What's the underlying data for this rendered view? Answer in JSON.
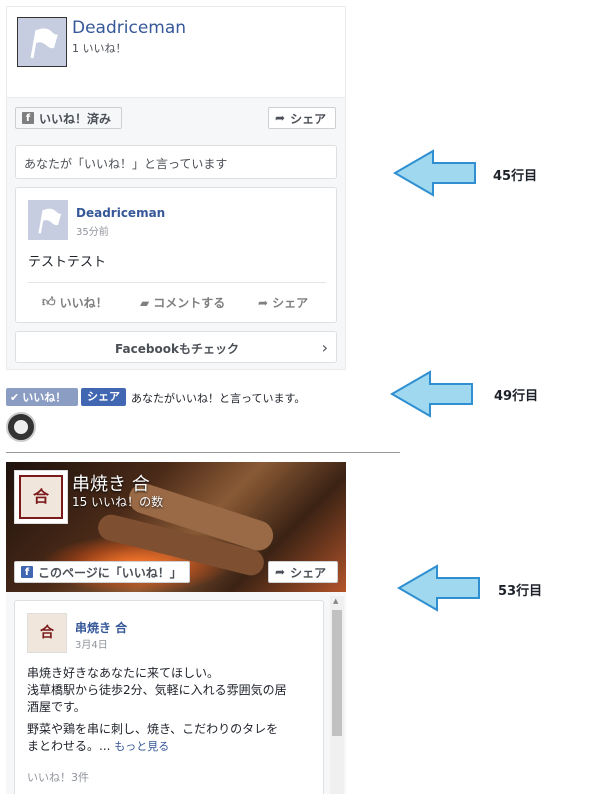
{
  "plugin1": {
    "page_name": "Deadriceman",
    "likes": "1 いいね！",
    "liked_button": "いいね！済み",
    "share_button": "シェア",
    "you_like": "あなたが「いいね！」と言っています",
    "post": {
      "author": "Deadriceman",
      "time": "35分前",
      "text": "テストテスト",
      "like": "いいね！",
      "comment": "コメントする",
      "share": "シェア"
    },
    "check_facebook": "Facebookもチェック"
  },
  "plugin2": {
    "like_button": "いいね！",
    "share_button": "シェア",
    "status_text": "あなたがいいね！と言っています。"
  },
  "plugin3": {
    "page_name": "串焼き 合",
    "likes": "15 いいね！の数",
    "like_page_button": "このページに「いいね！」",
    "share_button": "シェア",
    "post": {
      "author": "串焼き 合",
      "date": "3月4日",
      "text1": "串焼き好きなあなたに来てほしい。",
      "text2": "浅草橋駅から徒歩2分、気軽に入れる雰囲気の居",
      "text3": "酒屋です。",
      "text4": "野菜や鶏を串に刺し、焼き、こだわりのタレを",
      "text5": "まとわせる。...",
      "more": "もっと見る",
      "like_count": "いいね！3件"
    }
  },
  "annotations": {
    "line45": "45行目",
    "line49": "49行目",
    "line53": "53行目"
  },
  "colors": {
    "fb_blue": "#365899",
    "arrow_fill": "#9fd8ef",
    "arrow_stroke": "#2f8fd1",
    "dark_photo": "#2b1a12"
  }
}
